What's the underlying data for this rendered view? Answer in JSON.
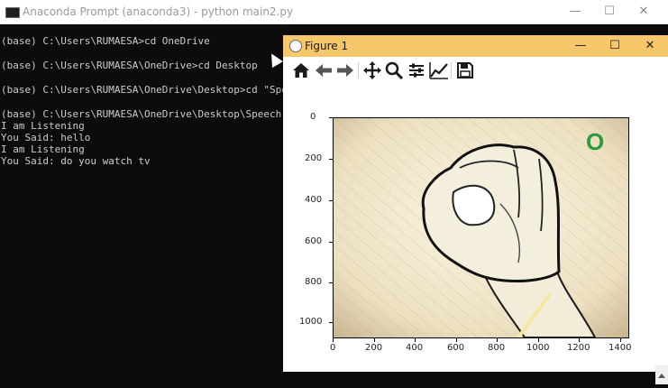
{
  "console": {
    "title": "Anaconda Prompt (anaconda3) - python  main2.py",
    "controls": {
      "minimize": "—",
      "maximize": "☐",
      "close": "✕"
    },
    "lines": [
      "(base) C:\\Users\\RUMAESA>cd OneDrive",
      "(base) C:\\Users\\RUMAESA\\OneDrive>cd Desktop",
      "(base) C:\\Users\\RUMAESA\\OneDrive\\Desktop>cd \"Speech",
      "(base) C:\\Users\\RUMAESA\\OneDrive\\Desktop\\Speech to s",
      "I am Listening",
      "You Said: hello",
      "I am Listening",
      "You Said: do you watch tv"
    ]
  },
  "figure": {
    "title": "Figure 1",
    "controls": {
      "minimize": "—",
      "maximize": "☐",
      "close": "✕"
    },
    "toolbar": [
      "home-icon",
      "back-arrow-icon",
      "forward-arrow-icon",
      "pan-icon",
      "zoom-icon",
      "configure-subplots-icon",
      "edit-axis-icon",
      "save-icon"
    ],
    "plot": {
      "overlay_letter": "O",
      "overlay_color": "#2e9a3e",
      "x_ticks": [
        "0",
        "200",
        "400",
        "600",
        "800",
        "1000",
        "1200",
        "1400"
      ],
      "y_ticks": [
        "0",
        "200",
        "400",
        "600",
        "800",
        "1000"
      ]
    }
  }
}
